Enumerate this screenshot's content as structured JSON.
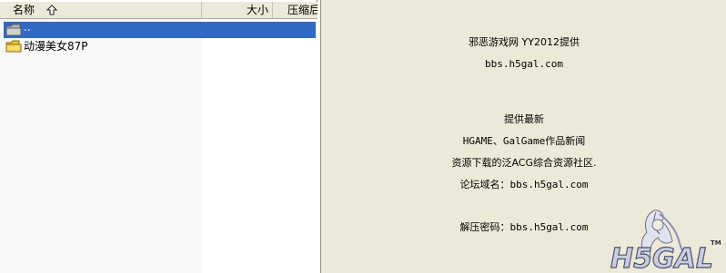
{
  "file_list": {
    "columns": {
      "name": "名称",
      "size": "大小",
      "packed": "压缩后"
    },
    "sort_indicator": "sort-ascending-arrow-icon",
    "rows": [
      {
        "name": "..",
        "type": "parent-folder",
        "selected": true
      },
      {
        "name": "动漫美女87P",
        "type": "folder",
        "selected": false
      }
    ],
    "selection_color": "#316ac5"
  },
  "preview": {
    "lines": [
      "邪恶游戏网   YY2012提供",
      "bbs.h5gal.com",
      "提供最新",
      "HGAME、GalGame作品新闻",
      "资源下载的泛ACG综合资源社区.",
      "论坛域名：bbs.h5gal.com",
      "解压密码：bbs.h5gal.com"
    ],
    "logo_text": "H5GAL",
    "logo_mark": "TM",
    "background": "#ece9d8"
  }
}
